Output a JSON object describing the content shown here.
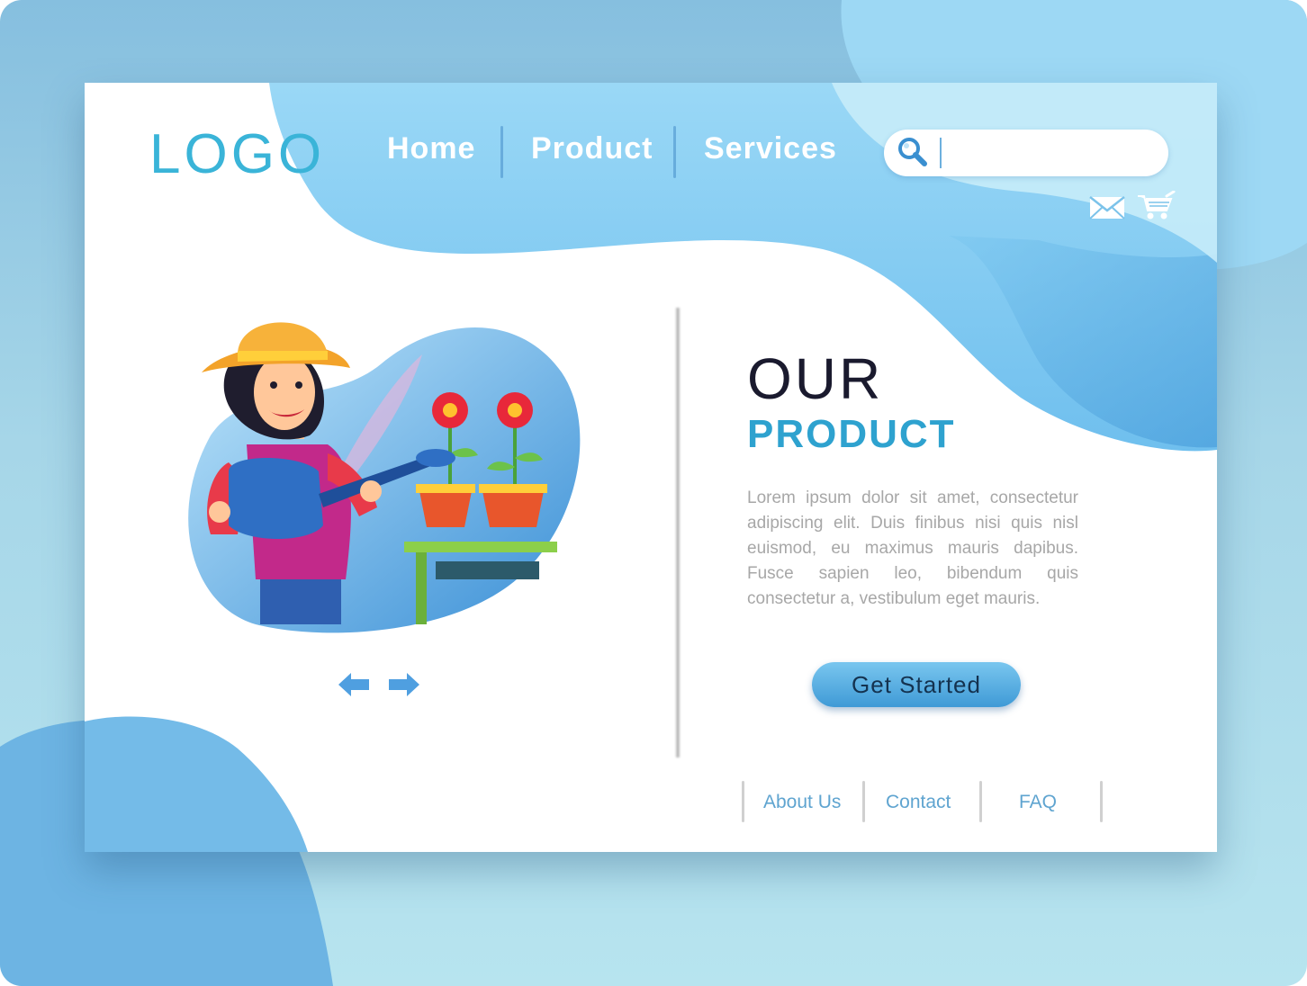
{
  "header": {
    "logo": "LOGO",
    "nav": [
      {
        "label": "Home"
      },
      {
        "label": "Product"
      },
      {
        "label": "Services"
      }
    ],
    "search": {
      "value": "",
      "icon": "search-icon"
    },
    "actions": [
      {
        "icon": "mail-icon"
      },
      {
        "icon": "cart-icon"
      }
    ]
  },
  "hero": {
    "title_line1": "OUR",
    "title_line2": "PRODUCT",
    "description": "Lorem ipsum dolor sit amet, consectetur adipiscing elit. Duis finibus nisi quis nisl euismod, eu maximus mauris dapibus. Fusce sapien leo, bibendum quis consectetur a, vestibulum eget mauris.",
    "cta_label": "Get Started",
    "carousel": {
      "prev_icon": "arrow-left-icon",
      "next_icon": "arrow-right-icon"
    }
  },
  "footer": {
    "links": [
      {
        "label": "About Us"
      },
      {
        "label": "Contact"
      },
      {
        "label": "FAQ"
      }
    ]
  },
  "colors": {
    "accent": "#2ea2cf",
    "wave_light": "#97d6f4",
    "wave_dark": "#4fa3dc",
    "background": "#a6d6e8"
  }
}
